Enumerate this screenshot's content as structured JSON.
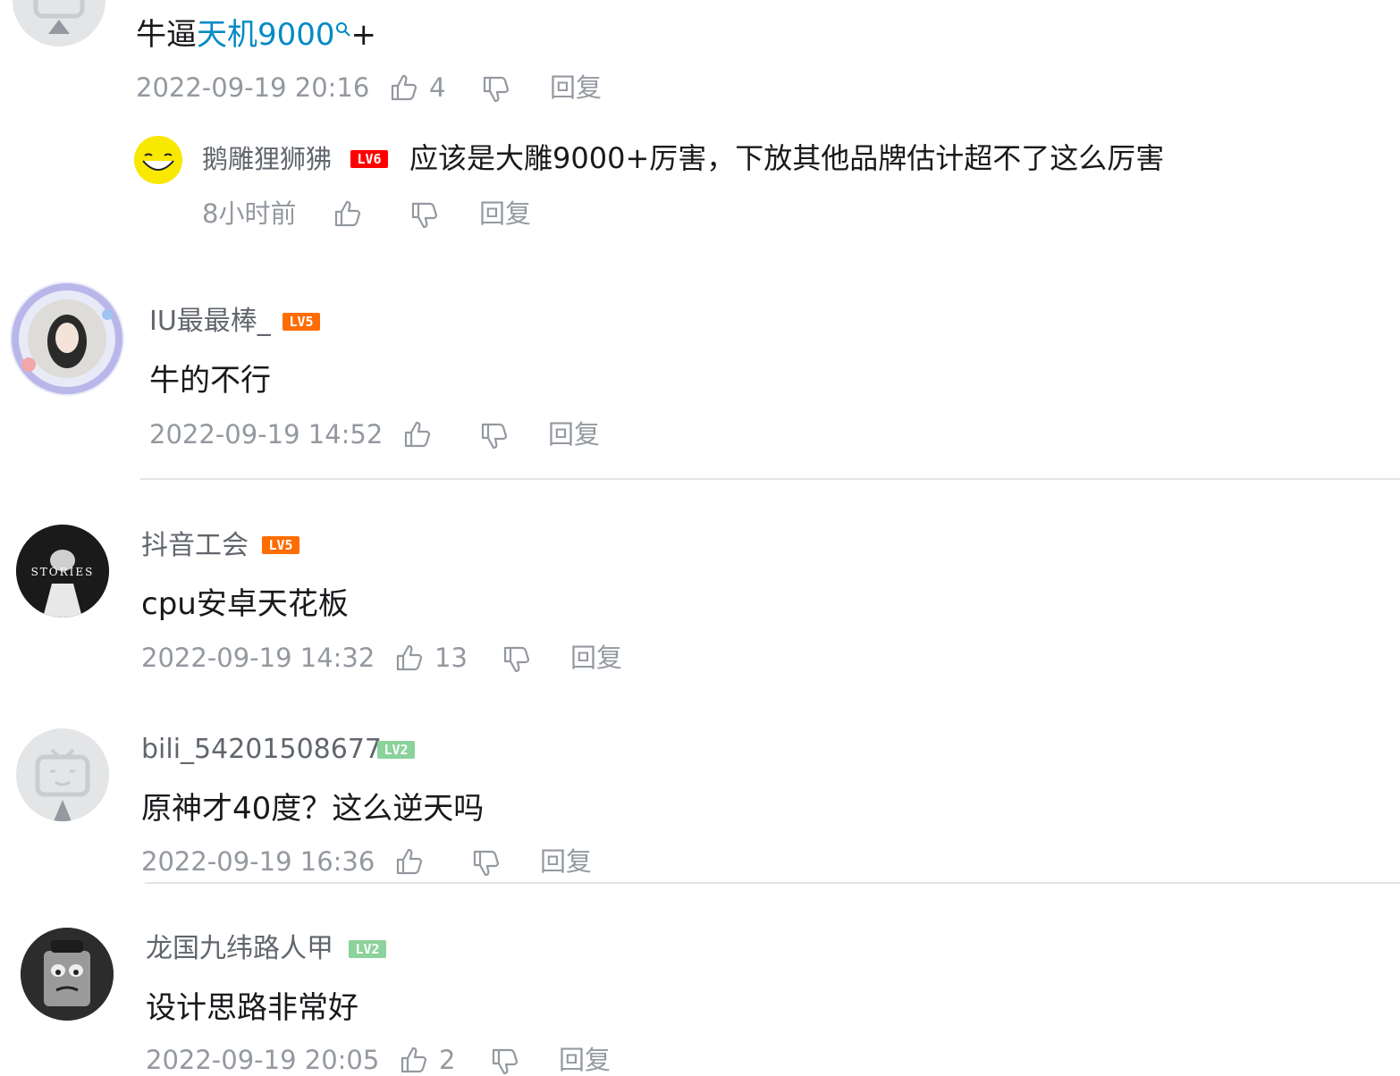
{
  "colors": {
    "link": "#008ac5",
    "lv5": "#ff6c00",
    "lv6": "#ff0000",
    "lv2": "#8bd29b",
    "meta": "#9499a0"
  },
  "top_comment": {
    "text_prefix": "牛逼",
    "link_text": "天机9000",
    "text_suffix": "+",
    "time": "2022-09-19 20:16",
    "likes": "4",
    "reply_label": "回复",
    "sub_reply": {
      "user": "鹅雕狸狮狒",
      "level": "LV6",
      "text": "应该是大雕9000+厉害，下放其他品牌估计超不了这么厉害",
      "time": "8小时前",
      "reply_label": "回复"
    }
  },
  "comments": [
    {
      "user": "IU最最棒_",
      "level": "LV5",
      "text": "牛的不行",
      "time": "2022-09-19 14:52",
      "likes": "",
      "reply_label": "回复",
      "avatar_icon": "girl-photo-avatar"
    },
    {
      "user": "抖音工会",
      "level": "LV5",
      "text": "cpu安卓天花板",
      "time": "2022-09-19 14:32",
      "likes": "13",
      "reply_label": "回复",
      "avatar_icon": "stories-avatar",
      "avatar_text": "STORIES"
    },
    {
      "user": "bili_54201508677",
      "level": "LV2",
      "text": "原神才40度？这么逆天吗",
      "time": "2022-09-19 16:36",
      "likes": "",
      "reply_label": "回复",
      "avatar_icon": "default-tv-avatar"
    },
    {
      "user": "龙国九纬路人甲",
      "level": "LV2",
      "text": "设计思路非常好",
      "time": "2022-09-19 20:05",
      "likes": "2",
      "reply_label": "回复",
      "avatar_icon": "spongebob-avatar"
    }
  ]
}
